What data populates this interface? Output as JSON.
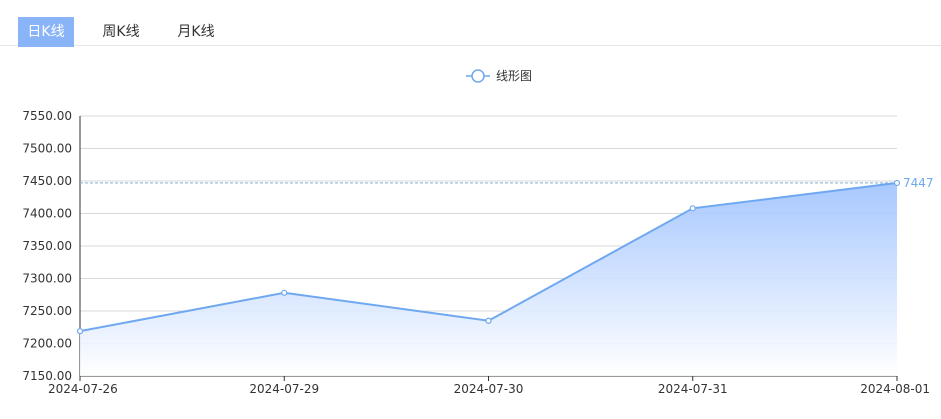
{
  "tabs": [
    {
      "label": "日K线",
      "active": true
    },
    {
      "label": "周K线",
      "active": false
    },
    {
      "label": "月K线",
      "active": false
    }
  ],
  "colors": {
    "line": "#6fa8f0",
    "area_top": "#9ec2ff",
    "area_bottom": "#ffffff",
    "active_tab": "#8ab4f8",
    "markline": "#8fb8d8",
    "grid": "#d9d9d9",
    "axis": "#333333"
  },
  "chart_data": {
    "type": "area",
    "legend": {
      "position": "top-center"
    },
    "x": [
      "2024-07-26",
      "2024-07-29",
      "2024-07-30",
      "2024-07-31",
      "2024-08-01"
    ],
    "series": [
      {
        "name": "线形图",
        "values": [
          7219,
          7278,
          7235,
          7408,
          7447
        ]
      }
    ],
    "ylim": [
      7150,
      7550
    ],
    "yticks": [
      "7150.00",
      "7200.00",
      "7250.00",
      "7300.00",
      "7350.00",
      "7400.00",
      "7450.00",
      "7500.00",
      "7550.00"
    ],
    "markline": {
      "value": 7447,
      "label": "7447"
    },
    "grid": true
  }
}
